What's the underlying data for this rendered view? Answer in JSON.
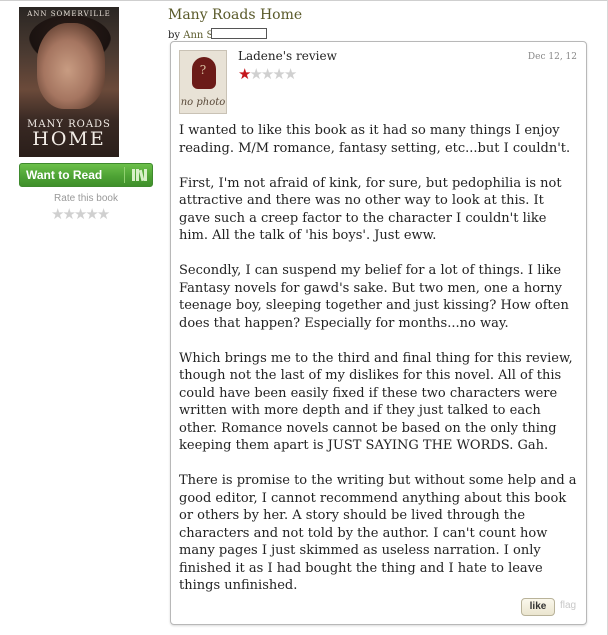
{
  "book": {
    "title": "Many Roads Home",
    "by_prefix": "by",
    "author_visible": "Ann S",
    "cover": {
      "author_text": "ANN SOMERVILLE",
      "title_line1": "MANY ROADS",
      "title_line2": "HOME"
    }
  },
  "actions": {
    "want_to_read": "Want to Read",
    "rate_label": "Rate this book",
    "rate_stars": 5
  },
  "review": {
    "reviewer": "Ladene's review",
    "date": "Dec 12, 12",
    "rating": 1,
    "max_rating": 5,
    "avatar_text": "no photo",
    "paragraphs": [
      "I wanted to like this book as it had so many things I enjoy reading. M/M romance, fantasy setting, etc...but I couldn't.",
      "First, I'm not afraid of kink, for sure, but pedophilia is not attractive and there was no other way to look at this. It gave such a creep factor to the character I couldn't like him. All the talk of 'his boys'. Just eww.",
      "Secondly, I can suspend my belief for a lot of things. I like Fantasy novels for gawd's sake. But two men, one a horny teenage boy, sleeping together and just kissing? How often does that happen? Especially for months...no way.",
      "Which brings me to the third and final thing for this review, though not the last of my dislikes for this novel. All of this could have been easily fixed if these two characters were written with more depth and if they just talked to each other. Romance novels cannot be based on the only thing keeping them apart is JUST SAYING THE WORDS. Gah.",
      "There is promise to the writing but without some help and a good editor, I cannot recommend anything about this book or others by her. A story should be lived through the characters and not told by the author. I can't count how many pages I just skimmed as useless narration. I only finished it as I had bought the thing and I hate to leave things unfinished."
    ],
    "like_label": "like",
    "flag_label": "flag"
  },
  "colors": {
    "title_olive": "#5a5a2a",
    "star_red": "#c4161c",
    "button_green": "#4ea335"
  }
}
